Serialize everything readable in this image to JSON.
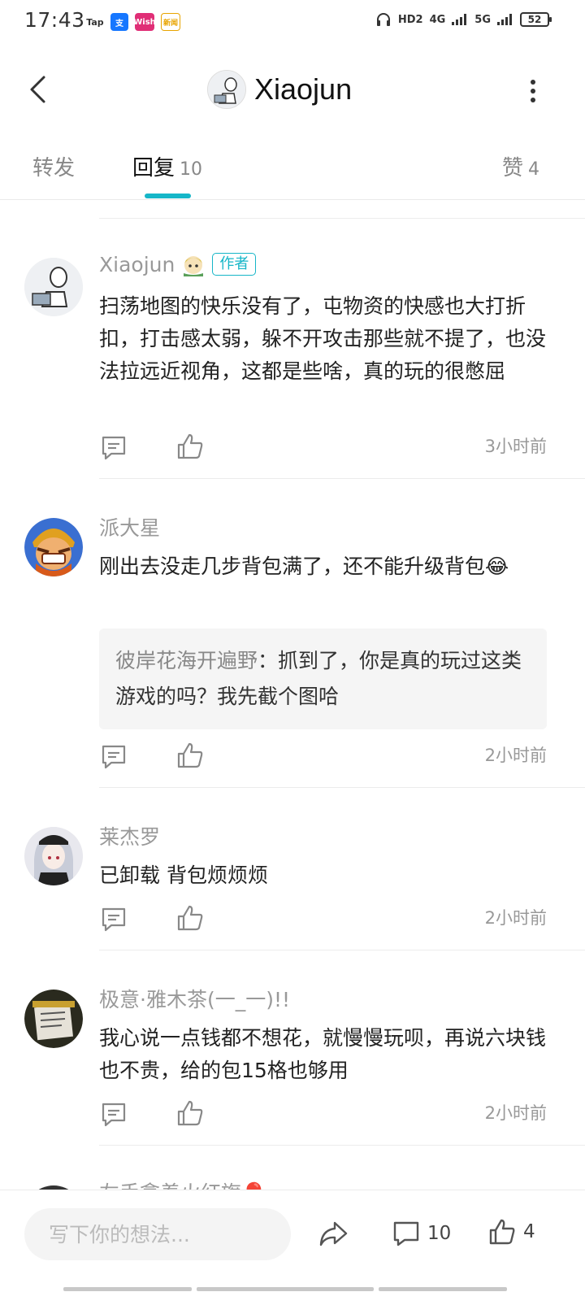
{
  "status_bar": {
    "time": "17:43",
    "apps": [
      "Tap",
      "支",
      "Wish",
      "新闻"
    ],
    "indicators": [
      "HD2",
      "4G",
      "5G"
    ],
    "battery": "52"
  },
  "nav": {
    "title": "Xiaojun",
    "avatar": "line-drawing-avatar"
  },
  "tabs": [
    {
      "label": "转发",
      "count": ""
    },
    {
      "label": "回复",
      "count": "10"
    },
    {
      "label": "赞",
      "count": "4"
    }
  ],
  "comments": [
    {
      "name": "Xiaojun",
      "author_tag": "作者",
      "text": "扫荡地图的快乐没有了，屯物资的快感也大打折扣，打击感太弱，躲不开攻击那些就不提了，也没法拉远近视角，这都是些啥，真的玩的很憋屈",
      "time": "3小时前"
    },
    {
      "name": "派大星",
      "text": "刚出去没走几步背包满了，还不能升级背包😂",
      "quote_user": "彼岸花海开遍野",
      "quote_text": "：抓到了，你是真的玩过这类游戏的吗？我先截个图哈",
      "time": "2小时前"
    },
    {
      "name": "莱杰罗",
      "text": "已卸载 背包烦烦烦",
      "time": "2小时前"
    },
    {
      "name": "极意·雅木茶(一_一)!!",
      "text": "我心说一点钱都不想花，就慢慢玩呗，再说六块钱也不贵，给的包15格也够用",
      "time": "2小时前"
    },
    {
      "name": "左手拿着火红旗🎈"
    }
  ],
  "bottom_bar": {
    "input_placeholder": "写下你的想法...",
    "comment_count": "10",
    "like_count": "4"
  },
  "colors": {
    "accent": "#16b6c8",
    "secondary_text": "#999999"
  }
}
